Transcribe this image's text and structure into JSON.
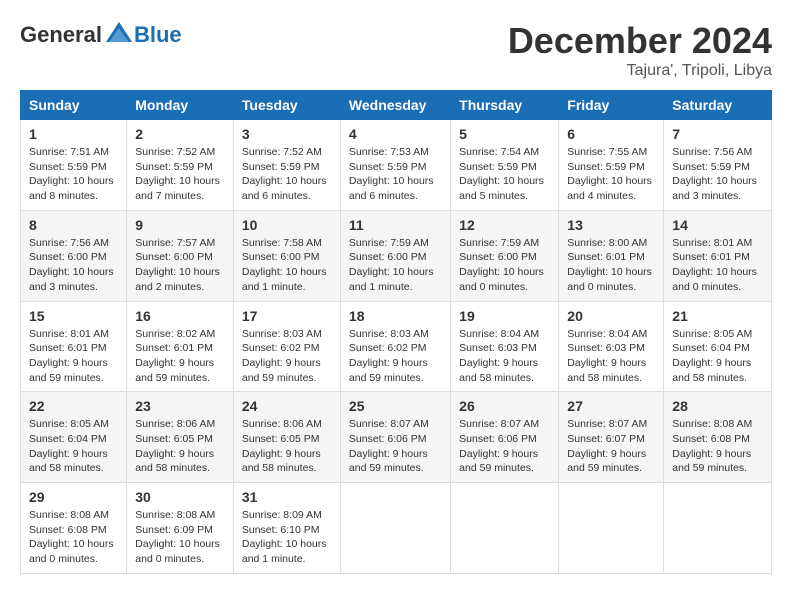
{
  "header": {
    "logo_general": "General",
    "logo_blue": "Blue",
    "month": "December 2024",
    "location": "Tajura', Tripoli, Libya"
  },
  "weekdays": [
    "Sunday",
    "Monday",
    "Tuesday",
    "Wednesday",
    "Thursday",
    "Friday",
    "Saturday"
  ],
  "weeks": [
    [
      {
        "day": "1",
        "sunrise": "7:51 AM",
        "sunset": "5:59 PM",
        "daylight": "10 hours and 8 minutes."
      },
      {
        "day": "2",
        "sunrise": "7:52 AM",
        "sunset": "5:59 PM",
        "daylight": "10 hours and 7 minutes."
      },
      {
        "day": "3",
        "sunrise": "7:52 AM",
        "sunset": "5:59 PM",
        "daylight": "10 hours and 6 minutes."
      },
      {
        "day": "4",
        "sunrise": "7:53 AM",
        "sunset": "5:59 PM",
        "daylight": "10 hours and 6 minutes."
      },
      {
        "day": "5",
        "sunrise": "7:54 AM",
        "sunset": "5:59 PM",
        "daylight": "10 hours and 5 minutes."
      },
      {
        "day": "6",
        "sunrise": "7:55 AM",
        "sunset": "5:59 PM",
        "daylight": "10 hours and 4 minutes."
      },
      {
        "day": "7",
        "sunrise": "7:56 AM",
        "sunset": "5:59 PM",
        "daylight": "10 hours and 3 minutes."
      }
    ],
    [
      {
        "day": "8",
        "sunrise": "7:56 AM",
        "sunset": "6:00 PM",
        "daylight": "10 hours and 3 minutes."
      },
      {
        "day": "9",
        "sunrise": "7:57 AM",
        "sunset": "6:00 PM",
        "daylight": "10 hours and 2 minutes."
      },
      {
        "day": "10",
        "sunrise": "7:58 AM",
        "sunset": "6:00 PM",
        "daylight": "10 hours and 1 minute."
      },
      {
        "day": "11",
        "sunrise": "7:59 AM",
        "sunset": "6:00 PM",
        "daylight": "10 hours and 1 minute."
      },
      {
        "day": "12",
        "sunrise": "7:59 AM",
        "sunset": "6:00 PM",
        "daylight": "10 hours and 0 minutes."
      },
      {
        "day": "13",
        "sunrise": "8:00 AM",
        "sunset": "6:01 PM",
        "daylight": "10 hours and 0 minutes."
      },
      {
        "day": "14",
        "sunrise": "8:01 AM",
        "sunset": "6:01 PM",
        "daylight": "10 hours and 0 minutes."
      }
    ],
    [
      {
        "day": "15",
        "sunrise": "8:01 AM",
        "sunset": "6:01 PM",
        "daylight": "9 hours and 59 minutes."
      },
      {
        "day": "16",
        "sunrise": "8:02 AM",
        "sunset": "6:01 PM",
        "daylight": "9 hours and 59 minutes."
      },
      {
        "day": "17",
        "sunrise": "8:03 AM",
        "sunset": "6:02 PM",
        "daylight": "9 hours and 59 minutes."
      },
      {
        "day": "18",
        "sunrise": "8:03 AM",
        "sunset": "6:02 PM",
        "daylight": "9 hours and 59 minutes."
      },
      {
        "day": "19",
        "sunrise": "8:04 AM",
        "sunset": "6:03 PM",
        "daylight": "9 hours and 58 minutes."
      },
      {
        "day": "20",
        "sunrise": "8:04 AM",
        "sunset": "6:03 PM",
        "daylight": "9 hours and 58 minutes."
      },
      {
        "day": "21",
        "sunrise": "8:05 AM",
        "sunset": "6:04 PM",
        "daylight": "9 hours and 58 minutes."
      }
    ],
    [
      {
        "day": "22",
        "sunrise": "8:05 AM",
        "sunset": "6:04 PM",
        "daylight": "9 hours and 58 minutes."
      },
      {
        "day": "23",
        "sunrise": "8:06 AM",
        "sunset": "6:05 PM",
        "daylight": "9 hours and 58 minutes."
      },
      {
        "day": "24",
        "sunrise": "8:06 AM",
        "sunset": "6:05 PM",
        "daylight": "9 hours and 58 minutes."
      },
      {
        "day": "25",
        "sunrise": "8:07 AM",
        "sunset": "6:06 PM",
        "daylight": "9 hours and 59 minutes."
      },
      {
        "day": "26",
        "sunrise": "8:07 AM",
        "sunset": "6:06 PM",
        "daylight": "9 hours and 59 minutes."
      },
      {
        "day": "27",
        "sunrise": "8:07 AM",
        "sunset": "6:07 PM",
        "daylight": "9 hours and 59 minutes."
      },
      {
        "day": "28",
        "sunrise": "8:08 AM",
        "sunset": "6:08 PM",
        "daylight": "9 hours and 59 minutes."
      }
    ],
    [
      {
        "day": "29",
        "sunrise": "8:08 AM",
        "sunset": "6:08 PM",
        "daylight": "10 hours and 0 minutes."
      },
      {
        "day": "30",
        "sunrise": "8:08 AM",
        "sunset": "6:09 PM",
        "daylight": "10 hours and 0 minutes."
      },
      {
        "day": "31",
        "sunrise": "8:09 AM",
        "sunset": "6:10 PM",
        "daylight": "10 hours and 1 minute."
      },
      null,
      null,
      null,
      null
    ]
  ],
  "labels": {
    "sunrise": "Sunrise:",
    "sunset": "Sunset:",
    "daylight": "Daylight:"
  }
}
